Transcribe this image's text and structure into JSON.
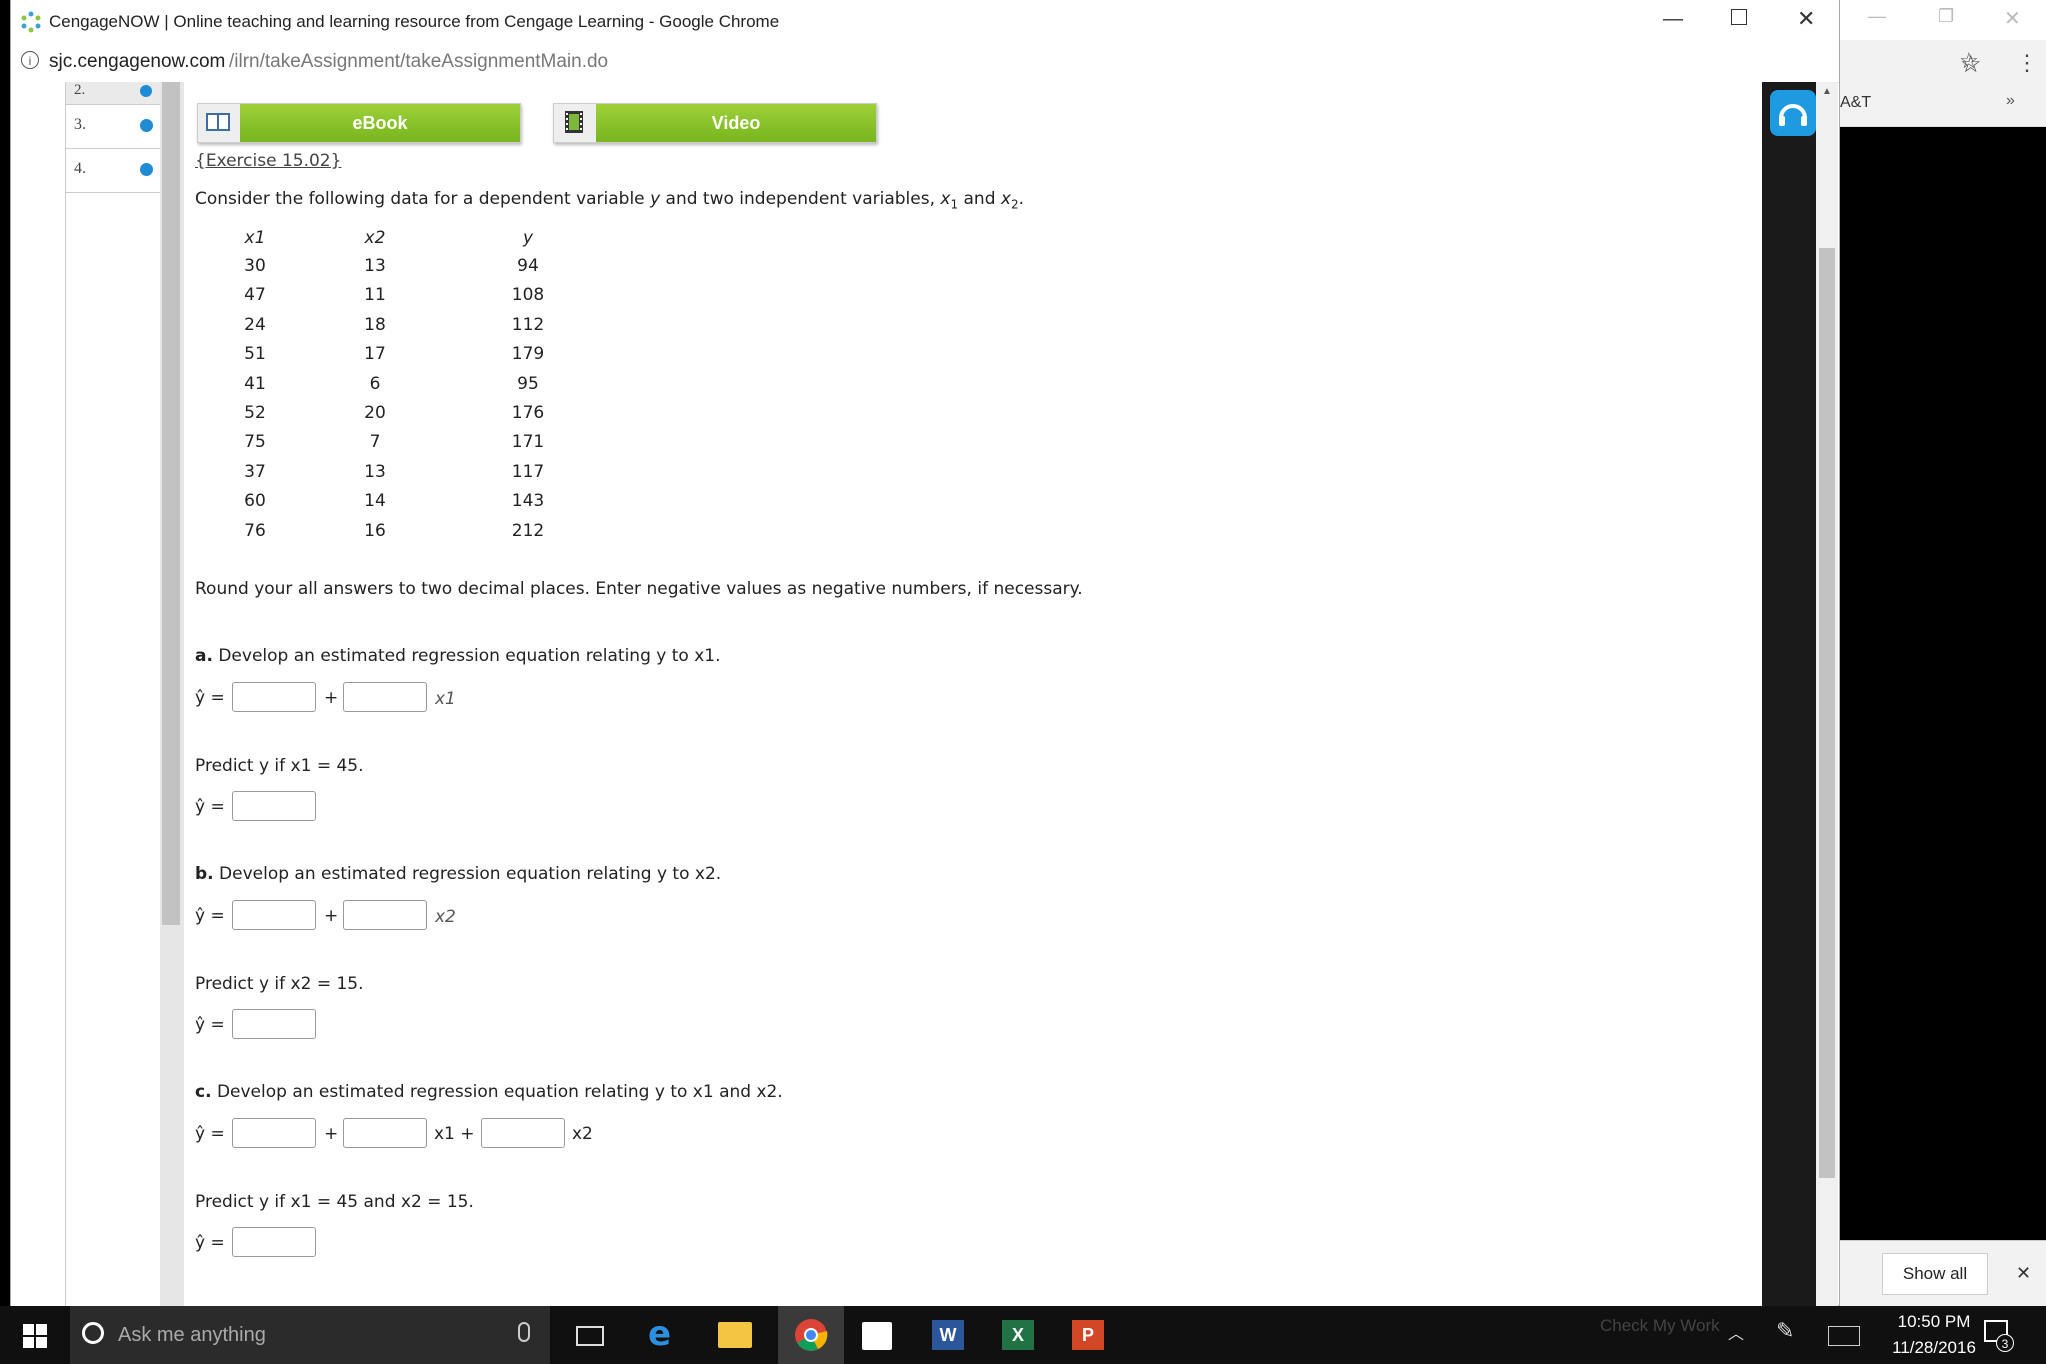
{
  "window": {
    "title": "CengageNOW | Online teaching and learning resource from Cengage Learning - Google Chrome",
    "url_host": "sjc.cengagenow.com",
    "url_path": "/ilrn/takeAssignment/takeAssignmentMain.do"
  },
  "background_window": {
    "bookmark": "A&T",
    "chevron": "»",
    "show_all": "Show all",
    "close": "✕"
  },
  "nav": {
    "items": [
      {
        "label": "2."
      },
      {
        "label": "3."
      },
      {
        "label": "4."
      }
    ]
  },
  "resources": {
    "ebook_label": "eBook",
    "video_label": "Video"
  },
  "question": {
    "exercise": "{Exercise 15.02}",
    "intro_prefix": "Consider the following data for a dependent variable ",
    "intro_y": "y",
    "intro_mid": " and two independent variables, ",
    "intro_x1": "x",
    "intro_x1_sub": "1",
    "intro_and": " and ",
    "intro_x2": "x",
    "intro_x2_sub": "2",
    "intro_end": ".",
    "table": {
      "headers": [
        "x1",
        "x2",
        "y"
      ],
      "rows": [
        [
          "30",
          "13",
          "94"
        ],
        [
          "47",
          "11",
          "108"
        ],
        [
          "24",
          "18",
          "112"
        ],
        [
          "51",
          "17",
          "179"
        ],
        [
          "41",
          "6",
          "95"
        ],
        [
          "52",
          "20",
          "176"
        ],
        [
          "75",
          "7",
          "171"
        ],
        [
          "37",
          "13",
          "117"
        ],
        [
          "60",
          "14",
          "143"
        ],
        [
          "76",
          "16",
          "212"
        ]
      ]
    },
    "round_note": "Round your all answers to two decimal places. Enter negative values as negative numbers, if necessary.",
    "part_a": "a.",
    "part_a_text": " Develop an estimated regression equation relating y to x1.",
    "predict_a": "Predict y if x1 = 45.",
    "part_b": "b.",
    "part_b_text": " Develop an estimated regression equation relating y to x2.",
    "predict_b": "Predict y if x2 = 15.",
    "part_c": "c.",
    "part_c_text": " Develop an estimated regression equation relating y to x1 and x2.",
    "predict_c": "Predict y if x1 = 45 and x2 = 15.",
    "yhat": "ŷ =",
    "plus": "+",
    "x1_term": "x1",
    "x2_term": "x2",
    "x1_plain": "x1 +",
    "x2_plain": "x2"
  },
  "taskbar": {
    "search_placeholder": "Ask me anything",
    "check_my_work": "Check My Work",
    "time": "10:50 PM",
    "date": "11/28/2016",
    "notification_count": "3"
  }
}
